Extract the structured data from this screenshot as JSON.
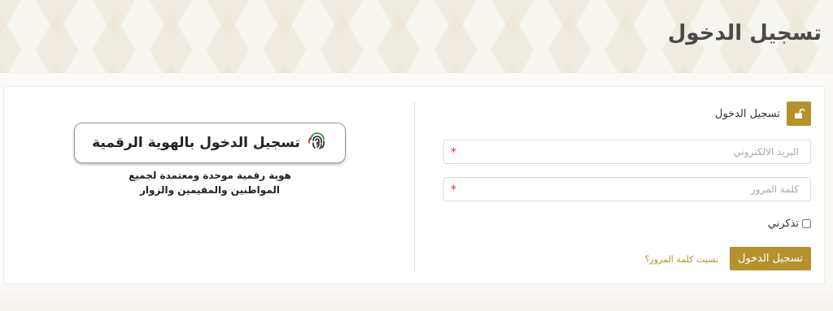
{
  "page": {
    "title": "تسجيل الدخول"
  },
  "login": {
    "heading": "تسجيل الدخول",
    "lock_icon": "unlock-icon",
    "email_placeholder": "البريد الالكتروني",
    "password_placeholder": "كلمة المرور",
    "required_mark": "*",
    "remember_label": "تذكرني",
    "remember_checked": false,
    "submit_label": "تسجيل الدخول",
    "forgot_label": "نسيت كلمة المرور؟"
  },
  "uaepass": {
    "button_label": "تسجيل الدخول بالهوية الرقمية",
    "icon": "fingerprint-icon",
    "description_line1": "هوية رقمية موحدة ومعتمدة لجميع",
    "description_line2": "المواطنين والمقيمين والزوار"
  },
  "colors": {
    "accent": "#b4932d",
    "required": "#d0342c",
    "title_text": "#4a4a4a"
  }
}
